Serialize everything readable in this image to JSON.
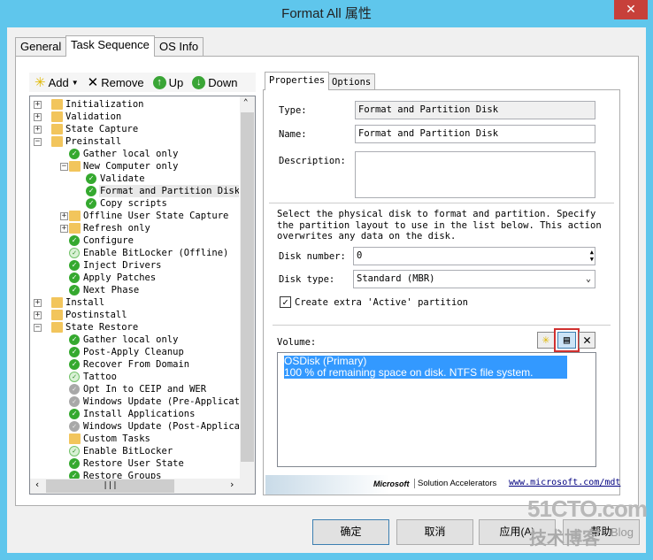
{
  "window": {
    "title": "Format All 属性",
    "close": "✕"
  },
  "tabs": [
    "General",
    "Task Sequence",
    "OS Info"
  ],
  "toolbar": {
    "add": "Add",
    "remove": "Remove",
    "up": "Up",
    "down": "Down"
  },
  "tree": [
    {
      "label": "Initialization",
      "level": 0,
      "icon": "folder",
      "expander": "+"
    },
    {
      "label": "Validation",
      "level": 0,
      "icon": "folder",
      "expander": "+"
    },
    {
      "label": "State Capture",
      "level": 0,
      "icon": "folder",
      "expander": "+"
    },
    {
      "label": "Preinstall",
      "level": 0,
      "icon": "folder",
      "expander": "−"
    },
    {
      "label": "Gather local only",
      "level": 1,
      "icon": "check"
    },
    {
      "label": "New Computer only",
      "level": 1,
      "icon": "folder",
      "expander": "−"
    },
    {
      "label": "Validate",
      "level": 2,
      "icon": "check"
    },
    {
      "label": "Format and Partition Disk",
      "level": 2,
      "icon": "check",
      "selected": true
    },
    {
      "label": "Copy scripts",
      "level": 2,
      "icon": "check"
    },
    {
      "label": "Offline User State Capture",
      "level": 1,
      "icon": "folder",
      "expander": "+"
    },
    {
      "label": "Refresh only",
      "level": 1,
      "icon": "folder",
      "expander": "+"
    },
    {
      "label": "Configure",
      "level": 1,
      "icon": "check"
    },
    {
      "label": "Enable BitLocker (Offline)",
      "level": 1,
      "icon": "light"
    },
    {
      "label": "Inject Drivers",
      "level": 1,
      "icon": "check"
    },
    {
      "label": "Apply Patches",
      "level": 1,
      "icon": "check"
    },
    {
      "label": "Next Phase",
      "level": 1,
      "icon": "check"
    },
    {
      "label": "Install",
      "level": 0,
      "icon": "folder",
      "expander": "+"
    },
    {
      "label": "Postinstall",
      "level": 0,
      "icon": "folder",
      "expander": "+"
    },
    {
      "label": "State Restore",
      "level": 0,
      "icon": "folder",
      "expander": "−"
    },
    {
      "label": "Gather local only",
      "level": 1,
      "icon": "check"
    },
    {
      "label": "Post-Apply Cleanup",
      "level": 1,
      "icon": "check"
    },
    {
      "label": "Recover From Domain",
      "level": 1,
      "icon": "check"
    },
    {
      "label": "Tattoo",
      "level": 1,
      "icon": "light"
    },
    {
      "label": "Opt In to CEIP and WER",
      "level": 1,
      "icon": "gray"
    },
    {
      "label": "Windows Update (Pre-Applicatio",
      "level": 1,
      "icon": "gray"
    },
    {
      "label": "Install Applications",
      "level": 1,
      "icon": "check"
    },
    {
      "label": "Windows Update (Post-Applicati",
      "level": 1,
      "icon": "gray"
    },
    {
      "label": "Custom Tasks",
      "level": 1,
      "icon": "folder"
    },
    {
      "label": "Enable BitLocker",
      "level": 1,
      "icon": "light"
    },
    {
      "label": "Restore User State",
      "level": 1,
      "icon": "check"
    },
    {
      "label": "Restore Groups",
      "level": 1,
      "icon": "check"
    }
  ],
  "right": {
    "tabs": [
      "Properties",
      "Options"
    ],
    "type_label": "Type:",
    "type_value": "Format and Partition Disk",
    "name_label": "Name:",
    "name_value": "Format and Partition Disk",
    "desc_label": "Description:",
    "desc_value": "",
    "instructions": "Select the physical disk to format and partition.  Specify the partition layout to use in the list below. This action overwrites any data on the disk.",
    "disk_number_label": "Disk number:",
    "disk_number": "0",
    "disk_type_label": "Disk type:",
    "disk_type": "Standard (MBR)",
    "active_partition_label": "Create extra 'Active' partition",
    "active_partition_checked": true,
    "volume_label": "Volume:",
    "volume_line1": "OSDisk (Primary)",
    "volume_line2": "100 % of remaining space on disk. NTFS file system.",
    "brand": "Microsoft",
    "brand_sub": "Solution Accelerators",
    "link": "www.microsoft.com/mdt"
  },
  "buttons": {
    "ok": "确定",
    "cancel": "取消",
    "apply": "应用(A)",
    "help": "帮助"
  },
  "watermark": {
    "site": "51CTO.com",
    "sub": "技术博客",
    "blog": "Blog"
  },
  "colors": {
    "titlebar": "#5fc6ec",
    "selection": "#3399ff",
    "highlight_box": "#d0302f"
  }
}
